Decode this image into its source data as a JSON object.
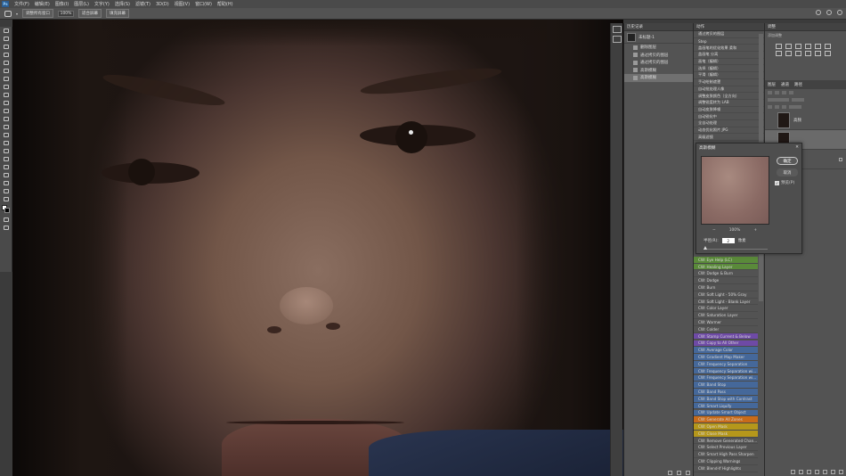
{
  "menubar": {
    "logo": "Ps",
    "items": [
      "文件(F)",
      "编辑(E)",
      "图像(I)",
      "图层(L)",
      "文字(Y)",
      "选择(S)",
      "滤镜(T)",
      "3D(D)",
      "视图(V)",
      "窗口(W)",
      "帮助(H)"
    ]
  },
  "options": {
    "btn1": "调整所有窗口",
    "zoom": "100%",
    "btn2": "适合屏幕",
    "btn3": "填充屏幕"
  },
  "history": {
    "title": "历史记录",
    "snapshot": "未标题-1",
    "items": [
      "删除图层",
      "通过拷贝的图层",
      "通过拷贝的图层",
      "高斯模糊",
      "高斯模糊"
    ]
  },
  "actions": {
    "title": "动作",
    "top": [
      "通过拷贝的图层",
      "Step",
      "盖画笔的优化效果 柔和",
      "盖画笔 分离",
      "画笔（编辑）",
      "选择（编辑）",
      "平滑（编辑）",
      "手动绘制遮罩",
      "自动批处理人像",
      "调整皮肤颜色（全方向）",
      "调整锐度转为 LAB",
      "自动皮肤降噪",
      "自动锐化中",
      "全自动处理",
      "动态优化照片 JPG",
      "高级滤镜"
    ],
    "bottom": [
      {
        "label": "CW: Eye Help (LC)",
        "color": "green"
      },
      {
        "label": "CW: Healing Layer",
        "color": "green"
      },
      {
        "label": "CW: Dodge & Burn",
        "color": ""
      },
      {
        "label": "CW: Dodge",
        "color": ""
      },
      {
        "label": "CW: Burn",
        "color": ""
      },
      {
        "label": "CW: Soft Light - 50% Gray",
        "color": ""
      },
      {
        "label": "CW: Soft Light - Blank Layer",
        "color": ""
      },
      {
        "label": "CW: Color Layer",
        "color": ""
      },
      {
        "label": "CW: Saturation Layer",
        "color": ""
      },
      {
        "label": "CW: Warmer",
        "color": ""
      },
      {
        "label": "CW: Colder",
        "color": ""
      },
      {
        "label": "CW: Stamp Current & Below",
        "color": "purple"
      },
      {
        "label": "CW: Copy to All Other",
        "color": "purple"
      },
      {
        "label": "CW: Average Color",
        "color": "blue"
      },
      {
        "label": "CW: Gradient Map Maker",
        "color": "blue"
      },
      {
        "label": "CW: Frequency Separation",
        "color": "blue"
      },
      {
        "label": "CW: Frequency Separation wi...",
        "color": "blue"
      },
      {
        "label": "CW: Frequency Separation wi...",
        "color": "blue"
      },
      {
        "label": "CW: Band Stop",
        "color": "blue"
      },
      {
        "label": "CW: Band Pass",
        "color": "blue"
      },
      {
        "label": "CW: Band Stop with Contrast",
        "color": "blue"
      },
      {
        "label": "CW: Smart Liquify",
        "color": "blue"
      },
      {
        "label": "CW: Update Smart Object",
        "color": "blue"
      },
      {
        "label": "CW: Generate All Zones",
        "color": "orange"
      },
      {
        "label": "CW: Open Mask",
        "color": "yellow"
      },
      {
        "label": "CW: Close Mask",
        "color": "yellow"
      },
      {
        "label": "CW: Remove Generated Chan...",
        "color": ""
      },
      {
        "label": "CW: Select Previous Layer",
        "color": ""
      },
      {
        "label": "CW: Smart High Pass Sharpen",
        "color": ""
      },
      {
        "label": "CW: Clipping Warnings",
        "color": ""
      },
      {
        "label": "CW: Blend-If Highlights",
        "color": ""
      }
    ]
  },
  "adjustments": {
    "title": "调整",
    "subtitle": "添加调整"
  },
  "layers": {
    "tabs": [
      "图层",
      "通道",
      "路径"
    ],
    "rows": [
      "高频",
      "",
      "背景"
    ]
  },
  "dialog": {
    "title": "高斯模糊",
    "close": "✕",
    "ok": "确定",
    "cancel": "取消",
    "preview_label": "预览(P)",
    "preview_check": "✓",
    "zoom_pct": "100%",
    "zoom_out": "−",
    "zoom_in": "+",
    "radius_label": "半径(R):",
    "radius_value": "2",
    "radius_unit": "像素"
  }
}
